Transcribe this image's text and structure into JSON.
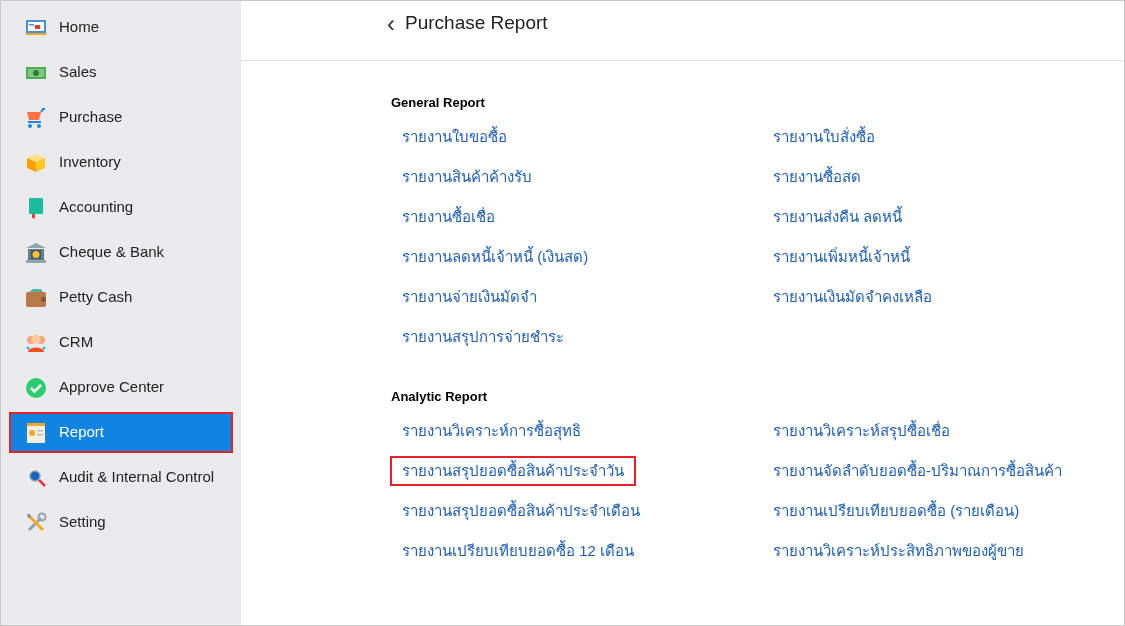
{
  "sidebar": {
    "items": [
      {
        "label": "Home",
        "selected": false,
        "highlighted": false
      },
      {
        "label": "Sales",
        "selected": false,
        "highlighted": false
      },
      {
        "label": "Purchase",
        "selected": false,
        "highlighted": false
      },
      {
        "label": "Inventory",
        "selected": false,
        "highlighted": false
      },
      {
        "label": "Accounting",
        "selected": false,
        "highlighted": false
      },
      {
        "label": "Cheque & Bank",
        "selected": false,
        "highlighted": false
      },
      {
        "label": "Petty Cash",
        "selected": false,
        "highlighted": false
      },
      {
        "label": "CRM",
        "selected": false,
        "highlighted": false
      },
      {
        "label": "Approve Center",
        "selected": false,
        "highlighted": false
      },
      {
        "label": "Report",
        "selected": true,
        "highlighted": true
      },
      {
        "label": "Audit & Internal Control",
        "selected": false,
        "highlighted": false
      },
      {
        "label": "Setting",
        "selected": false,
        "highlighted": false
      }
    ]
  },
  "header": {
    "back": "‹",
    "title": "Purchase Report"
  },
  "sections": [
    {
      "title": "General Report",
      "links": [
        {
          "label": "รายงานใบขอซื้อ",
          "highlighted": false
        },
        {
          "label": "รายงานใบสั่งซื้อ",
          "highlighted": false
        },
        {
          "label": "รายงานสินค้าค้างรับ",
          "highlighted": false
        },
        {
          "label": "รายงานซื้อสด",
          "highlighted": false
        },
        {
          "label": "รายงานซื้อเชื่อ",
          "highlighted": false
        },
        {
          "label": "รายงานส่งคืน ลดหนี้",
          "highlighted": false
        },
        {
          "label": "รายงานลดหนี้เจ้าหนี้ (เงินสด)",
          "highlighted": false
        },
        {
          "label": "รายงานเพิ่มหนี้เจ้าหนี้",
          "highlighted": false
        },
        {
          "label": "รายงานจ่ายเงินมัดจำ",
          "highlighted": false
        },
        {
          "label": "รายงานเงินมัดจำคงเหลือ",
          "highlighted": false
        },
        {
          "label": "รายงานสรุปการจ่ายชำระ",
          "highlighted": false
        }
      ]
    },
    {
      "title": "Analytic Report",
      "links": [
        {
          "label": "รายงานวิเคราะห์การซื้อสุทธิ",
          "highlighted": false
        },
        {
          "label": "รายงานวิเคราะห์สรุปซื้อเชื่อ",
          "highlighted": false
        },
        {
          "label": "รายงานสรุปยอดซื้อสินค้าประจำวัน",
          "highlighted": true
        },
        {
          "label": "รายงานจัดลำดับยอดซื้อ-ปริมาณการซื้อสินค้า",
          "highlighted": false
        },
        {
          "label": "รายงานสรุปยอดซื้อสินค้าประจำเดือน",
          "highlighted": false
        },
        {
          "label": "รายงานเปรียบเทียบยอดซื้อ (รายเดือน)",
          "highlighted": false
        },
        {
          "label": "รายงานเปรียบเทียบยอดซื้อ 12 เดือน",
          "highlighted": false
        },
        {
          "label": "รายงานวิเคราะห์ประสิทธิภาพของผู้ขาย",
          "highlighted": false
        }
      ]
    }
  ]
}
